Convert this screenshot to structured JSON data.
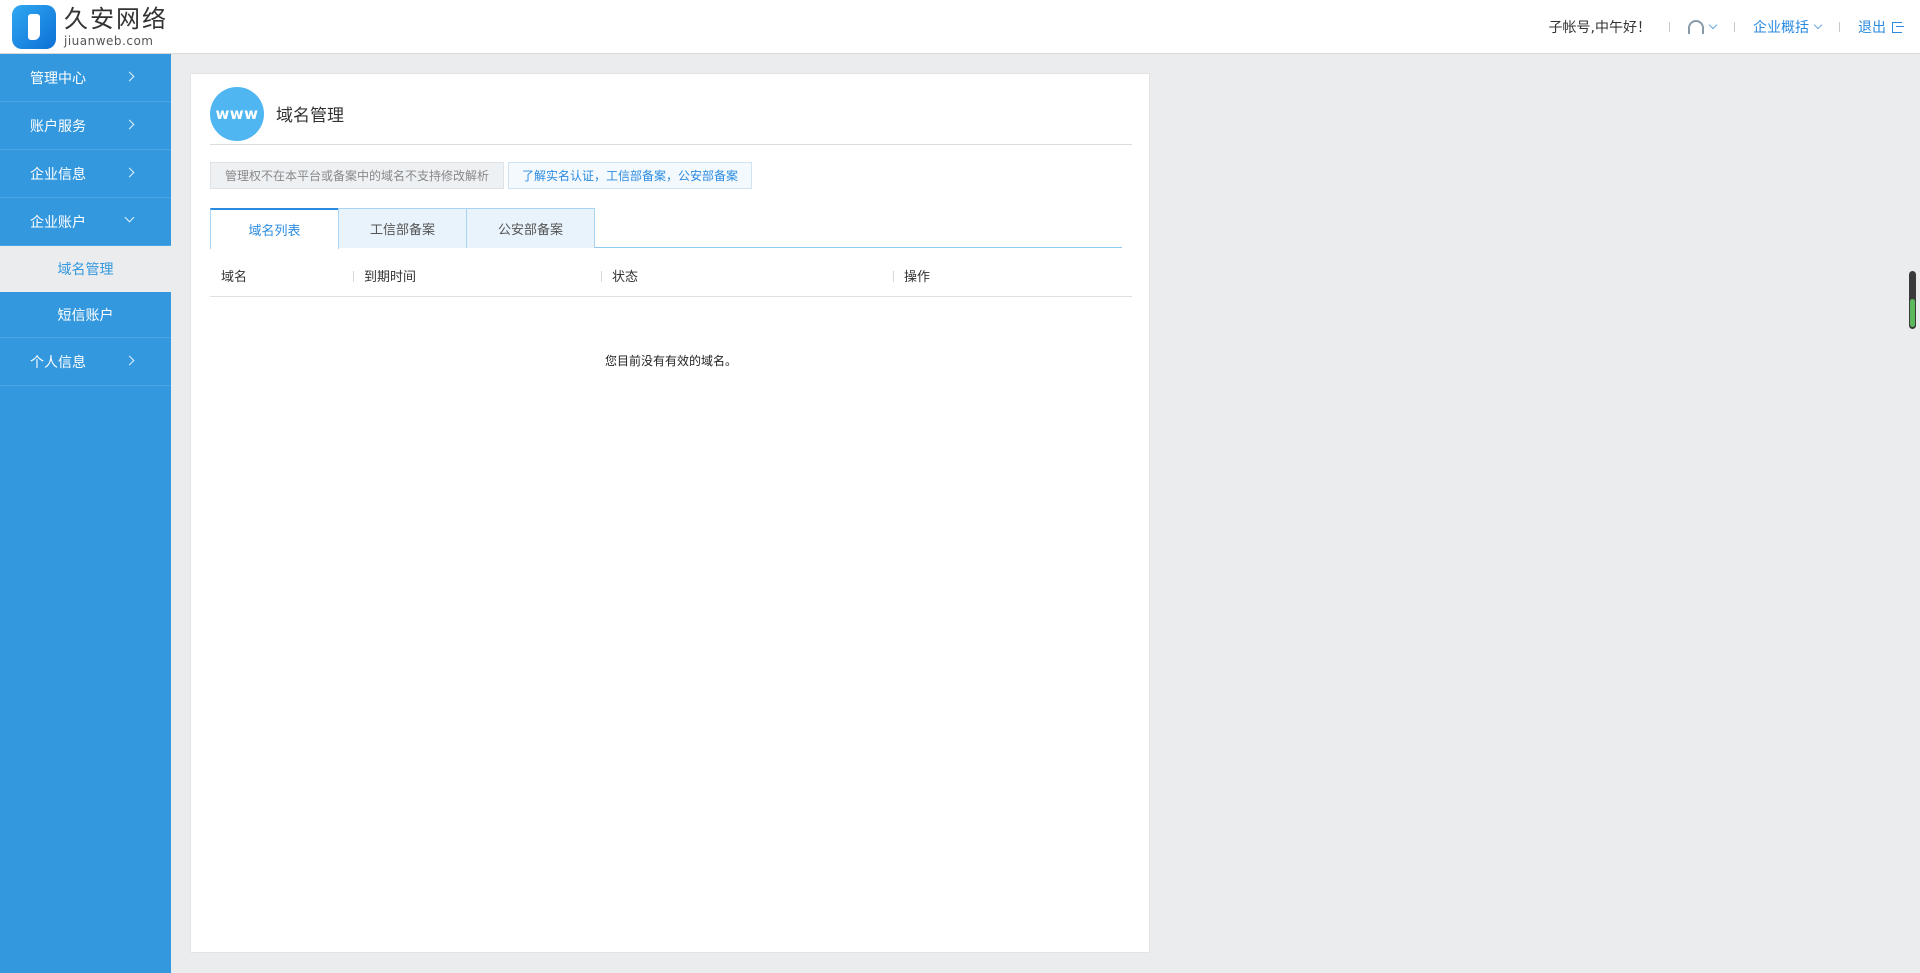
{
  "brand": {
    "name_cn": "久安网络",
    "domain": "jiuanweb.com",
    "mark_color": "#2b8be0"
  },
  "header": {
    "greeting": "子帐号,中午好！",
    "support_icon": "headset-icon",
    "company_overview": "企业概括",
    "logout": "退出"
  },
  "sidebar": {
    "color": "#3498de",
    "items": [
      {
        "label": "管理中心",
        "icon": "chevron-right-icon"
      },
      {
        "label": "账户服务",
        "icon": "chevron-right-icon"
      },
      {
        "label": "企业信息",
        "icon": "chevron-right-icon"
      },
      {
        "label": "企业账户",
        "icon": "chevron-down-icon",
        "expanded": true,
        "children": [
          {
            "label": "域名管理",
            "active": true
          },
          {
            "label": "短信账户",
            "active": false
          }
        ]
      },
      {
        "label": "个人信息",
        "icon": "chevron-right-icon"
      }
    ]
  },
  "main": {
    "badge": "www",
    "title": "域名管理",
    "notice": "管理权不在本平台或备案中的域名不支持修改解析",
    "notice_link": "了解实名认证，工信部备案，公安部备案",
    "tabs": [
      {
        "label": "域名列表",
        "active": true
      },
      {
        "label": "工信部备案",
        "active": false
      },
      {
        "label": "公安部备案",
        "active": false
      }
    ],
    "table": {
      "columns": [
        "域名",
        "到期时间",
        "状态",
        "操作"
      ],
      "rows": []
    },
    "empty_message": "您目前没有有效的域名。"
  }
}
